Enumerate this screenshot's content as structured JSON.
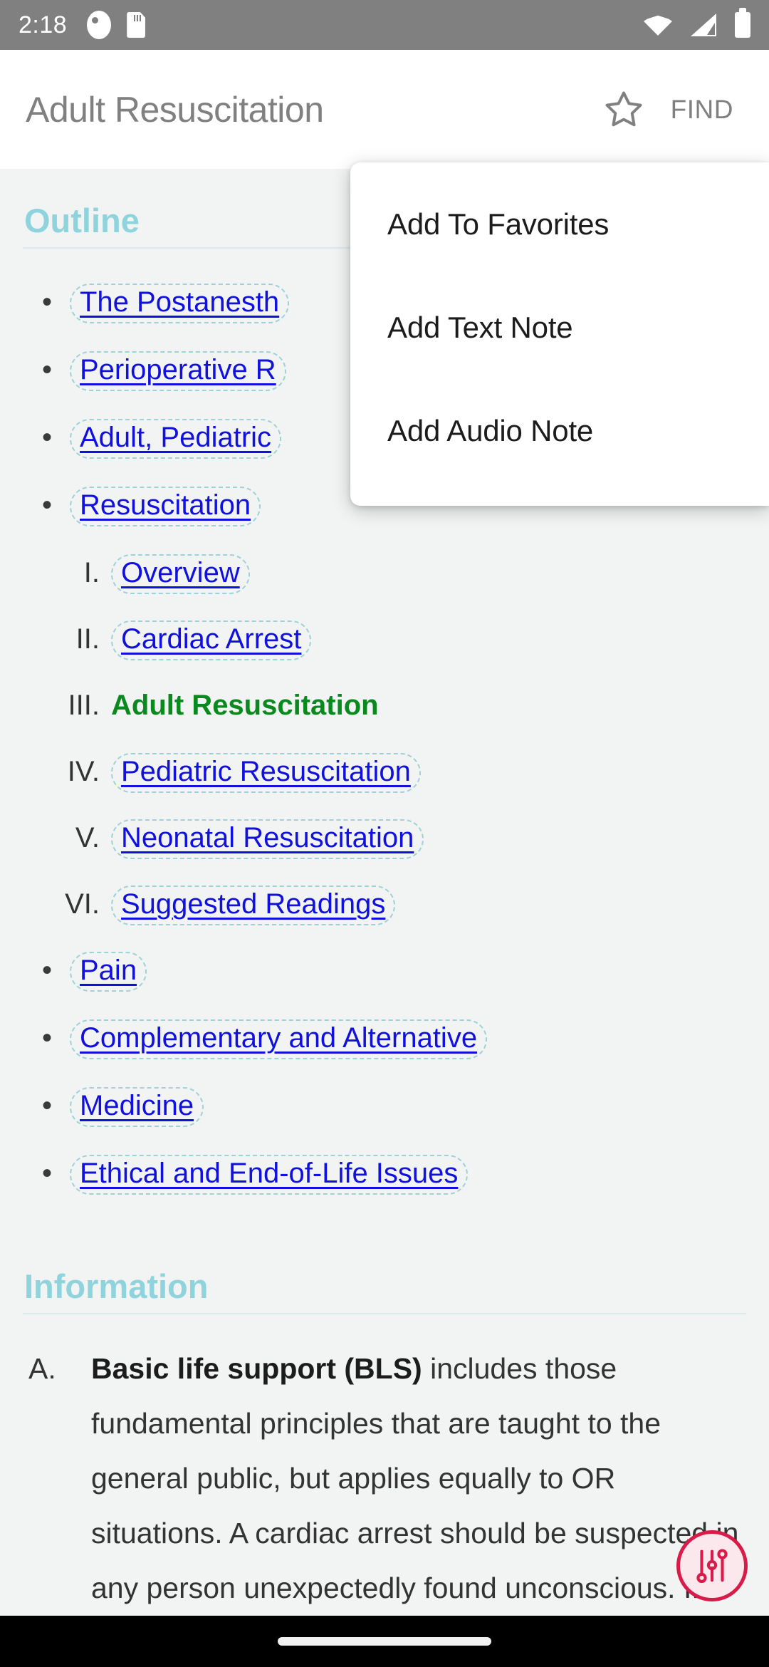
{
  "status_bar": {
    "clock": "2:18",
    "left_icons": [
      "alarm-icon",
      "sdcard-icon"
    ],
    "right_icons": [
      "wifi-icon",
      "signal-icon",
      "battery-icon"
    ],
    "background": "#808080"
  },
  "app_bar": {
    "title": "Adult Resuscitation",
    "favorite_icon": "star-outline-icon",
    "find_label": "FIND",
    "text_color": "#808080"
  },
  "menu": {
    "items": [
      {
        "label": "Add To Favorites"
      },
      {
        "label": "Add Text Note"
      },
      {
        "label": "Add Audio Note"
      }
    ]
  },
  "content": {
    "outline_heading": "Outline",
    "information_heading": "Information",
    "heading_color": "#8fd3dd",
    "link_color": "#1111dd",
    "current_color": "#0a8a1e",
    "outline_items": [
      {
        "label": "The Postanesth",
        "type": "link"
      },
      {
        "label": "Perioperative R",
        "type": "link"
      },
      {
        "label": "Adult, Pediatric",
        "type": "link"
      },
      {
        "label": "Resuscitation",
        "type": "link",
        "continuation": true
      }
    ],
    "sub_items": [
      {
        "numeral": "I.",
        "label": "Overview",
        "type": "link"
      },
      {
        "numeral": "II.",
        "label": "Cardiac Arrest",
        "type": "link"
      },
      {
        "numeral": "III.",
        "label": "Adult Resuscitation",
        "type": "current"
      },
      {
        "numeral": "IV.",
        "label": "Pediatric Resuscitation",
        "type": "link"
      },
      {
        "numeral": "V.",
        "label": "Neonatal Resuscitation",
        "type": "link"
      },
      {
        "numeral": "VI.",
        "label": "Suggested Readings",
        "type": "link"
      }
    ],
    "outline_items_tail": [
      {
        "label": "Pain",
        "type": "link"
      },
      {
        "label": "Complementary and Alternative",
        "type": "link"
      },
      {
        "label": "Medicine",
        "type": "link",
        "continuation": true
      },
      {
        "label": "Ethical and End-of-Life Issues",
        "type": "link"
      }
    ],
    "information_items": [
      {
        "marker": "A.",
        "bold_lead": "Basic life support (BLS)",
        "rest": " includes those fundamental principles that are taught to the general public, but applies equally to OR situations. A cardiac arrest should be suspected in any person unexpectedly found unconscious. If the subject is unarousable, the \"ABCDs\" (Airway"
      }
    ]
  },
  "fab": {
    "icon": "tune-sliders-icon",
    "border_color": "#d81b49",
    "fill_color": "#fbe8ec"
  },
  "nav_bar": {
    "gesture_pill": "home-gesture-pill",
    "background": "#000000"
  }
}
